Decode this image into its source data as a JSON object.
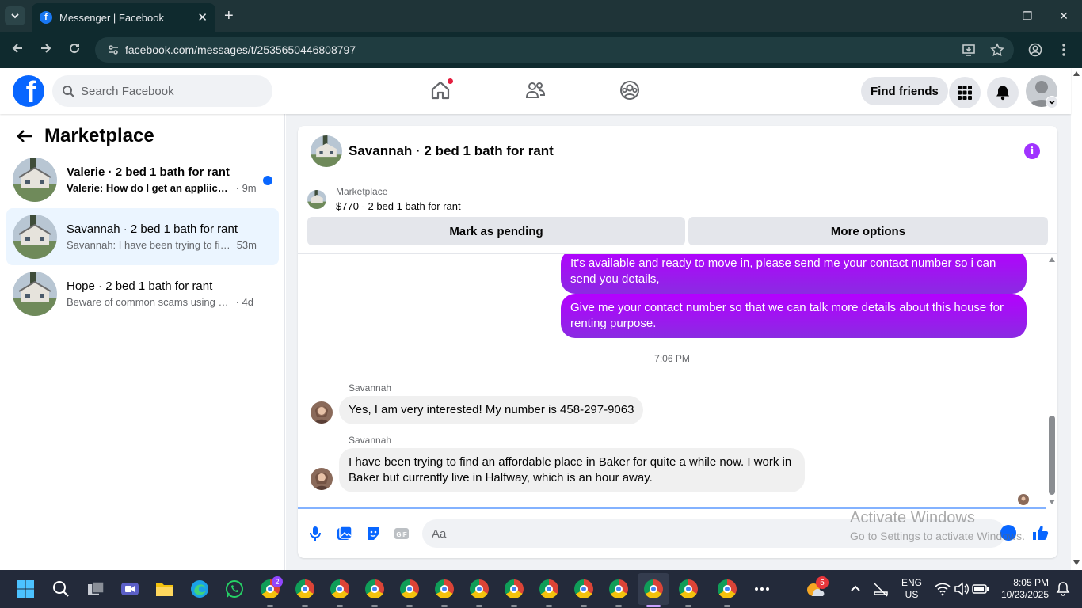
{
  "browser": {
    "tab_title": "Messenger | Facebook",
    "url": "facebook.com/messages/t/2535650446808797"
  },
  "fb_header": {
    "search_placeholder": "Search Facebook",
    "find_friends": "Find friends"
  },
  "left_panel": {
    "title": "Marketplace",
    "conversations": [
      {
        "name": "Valerie · 2 bed 1 bath for rant",
        "preview": "Valerie: How do I get an appliicati...",
        "time": "· 9m",
        "unread": true
      },
      {
        "name": "Savannah · 2 bed 1 bath for rant",
        "preview": "Savannah: I have been trying to find...",
        "time": "53m",
        "unread": false,
        "active": true
      },
      {
        "name": "Hope · 2 bed 1 bath for rant",
        "preview": "Beware of common scams using pay...",
        "time": "· 4d",
        "unread": false
      }
    ]
  },
  "chat": {
    "title": "Savannah · 2 bed 1 bath for rant",
    "marketplace_label": "Marketplace",
    "listing": "$770 - 2 bed 1 bath for rant",
    "mark_pending": "Mark as pending",
    "more_options": "More options",
    "messages_out": [
      "It's available and ready to move in, please send me your contact number so i can send you details,",
      "Give me your contact number so that we can talk more details about this house for renting purpose."
    ],
    "timestamp": "7:06 PM",
    "messages_in": [
      {
        "sender": "Savannah",
        "text": "Yes, I am very interested! My number is 458-297-9063"
      },
      {
        "sender": "Savannah",
        "text": "I have been trying to find an affordable place in Baker for quite a while now. I work in Baker but currently live in Halfway, which is an hour away."
      }
    ],
    "composer_placeholder": "Aa"
  },
  "watermark": {
    "line1": "Activate Windows",
    "line2": "Go to Settings to activate Windows."
  },
  "taskbar": {
    "lang1": "ENG",
    "lang2": "US",
    "time": "8:05 PM",
    "date": "10/23/2025",
    "weather_badge": "5",
    "app_badge": "2"
  },
  "colors": {
    "fb_blue": "#0866ff",
    "messenger_purple": "#a033ff",
    "browser_dark": "#0f2a2e"
  }
}
